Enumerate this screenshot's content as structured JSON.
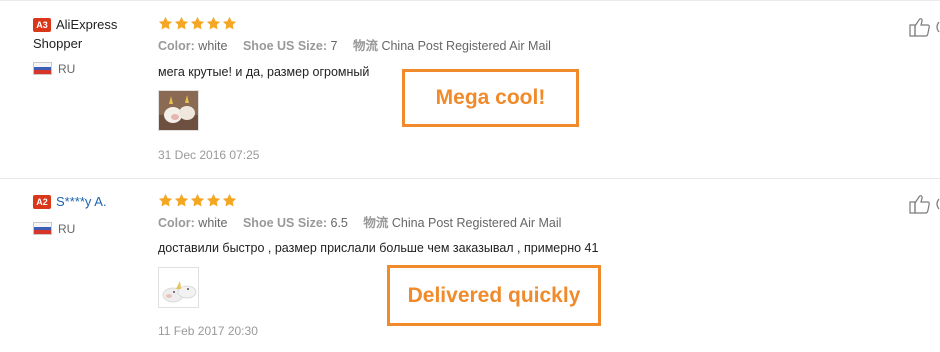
{
  "reviews": [
    {
      "badge": "A3",
      "user_line1": "AliExpress",
      "user_line2": "Shopper",
      "country": "RU",
      "rating": 5,
      "color_label": "Color:",
      "color_value": "white",
      "size_label": "Shoe US Size:",
      "size_value": "7",
      "shipping_label": "物流",
      "shipping_value": "China Post Registered Air Mail",
      "comment": "мега крутые! и да, размер огромный",
      "date": "31 Dec 2016 07:25",
      "callout": "Mega cool!"
    },
    {
      "badge": "A2",
      "user_line1": "S****y A.",
      "country": "RU",
      "rating": 5,
      "color_label": "Color:",
      "color_value": "white",
      "size_label": "Shoe US Size:",
      "size_value": "6.5",
      "shipping_label": "物流",
      "shipping_value": "China Post Registered Air Mail",
      "comment": "доставили быстро , размер прислали больше чем заказывал , примерно 41",
      "date": "11 Feb 2017 20:30",
      "callout": "Delivered quickly"
    }
  ],
  "colors": {
    "star": "#f5a623",
    "callout": "#f08a2a",
    "badge": "#d9361a",
    "link": "#1b63b0"
  },
  "icons": {
    "like": "thumbs-up-icon",
    "flag": "russia-flag-icon",
    "star": "star-icon"
  }
}
